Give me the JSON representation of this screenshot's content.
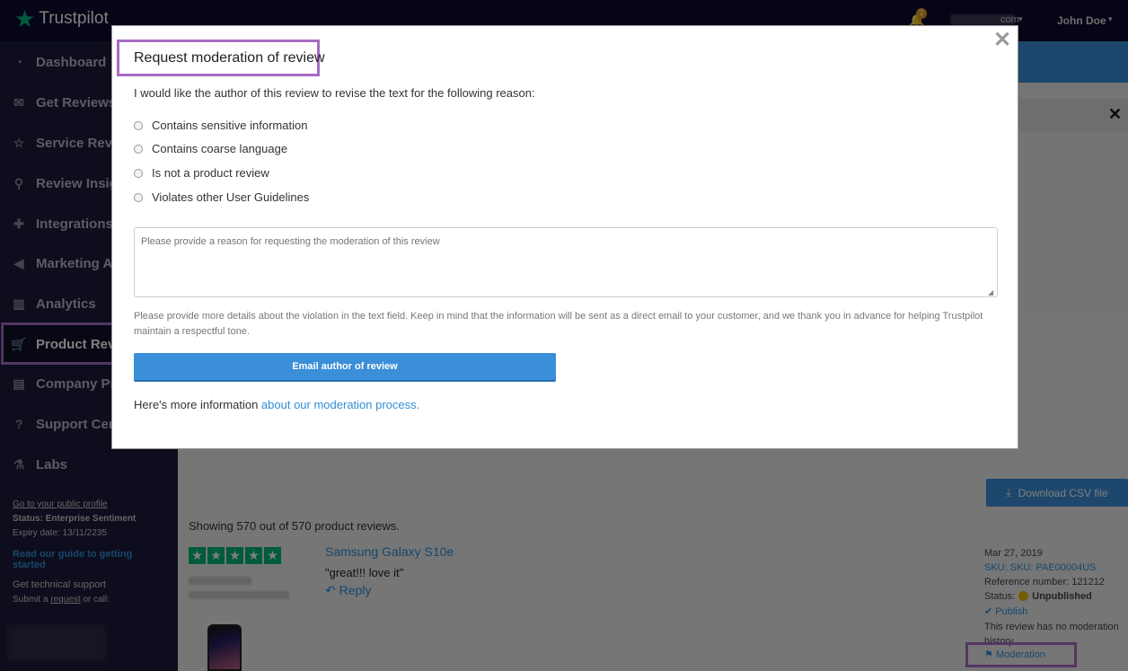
{
  "topbar": {
    "brand": "Trustpilot",
    "notification_count": "2",
    "account_suffix": "com",
    "user_name": "John Doe"
  },
  "sidebar": {
    "items": [
      {
        "label": "Dashboard",
        "icon": "dashboard-icon"
      },
      {
        "label": "Get Reviews",
        "icon": "envelope-icon"
      },
      {
        "label": "Service Reviews",
        "icon": "star-icon"
      },
      {
        "label": "Review Insights",
        "icon": "lightbulb-icon"
      },
      {
        "label": "Integrations",
        "icon": "puzzle-icon"
      },
      {
        "label": "Marketing Assets",
        "icon": "megaphone-icon"
      },
      {
        "label": "Analytics",
        "icon": "bar-chart-icon"
      },
      {
        "label": "Product Reviews",
        "icon": "cart-icon"
      },
      {
        "label": "Company Profile",
        "icon": "id-card-icon"
      },
      {
        "label": "Support Center",
        "icon": "question-icon"
      },
      {
        "label": "Labs",
        "icon": "flask-icon"
      }
    ],
    "public_profile_link": "Go to your public profile",
    "status": "Status: Enterprise Sentiment",
    "expiry": "Expiry date: 13/11/2235",
    "guide_link": "Read our guide to getting started",
    "support_heading": "Get technical support",
    "support_prefix": "Submit a ",
    "support_link": "request",
    "support_suffix": " or call:"
  },
  "main": {
    "download_csv": "Download CSV file",
    "showing": "Showing 570 out of 570 product reviews.",
    "review": {
      "product": "Samsung Galaxy S10e",
      "text": "\"great!!! love it\"",
      "reply": "Reply",
      "date": "Mar 27, 2019",
      "sku": "SKU: SKU: PAE00004US",
      "reference": "Reference number: 121212",
      "status_label": "Status:",
      "status_value": "Unpublished",
      "publish": "Publish",
      "moderation_history": "This review has no moderation history",
      "moderation": "Moderation"
    }
  },
  "modal": {
    "title": "Request moderation of review",
    "intro": "I would like the author of this review to revise the text for the following reason:",
    "reasons": [
      "Contains sensitive information",
      "Contains coarse language",
      "Is not a product review",
      "Violates other User Guidelines"
    ],
    "reason_placeholder": "Please provide a reason for requesting the moderation of this review",
    "help_text": "Please provide more details about the violation in the text field. Keep in mind that the information will be sent as a direct email to your customer, and we thank you in advance for helping Trustpilot maintain a respectful tone.",
    "email_button": "Email author of review",
    "more_info_prefix": "Here's more information ",
    "more_info_link": "about our moderation process",
    "more_info_suffix": "."
  },
  "colors": {
    "accent": "#3b8fd9",
    "brand_green": "#00b67a",
    "highlight": "#a66cc4",
    "status_pending": "#e8b800"
  }
}
